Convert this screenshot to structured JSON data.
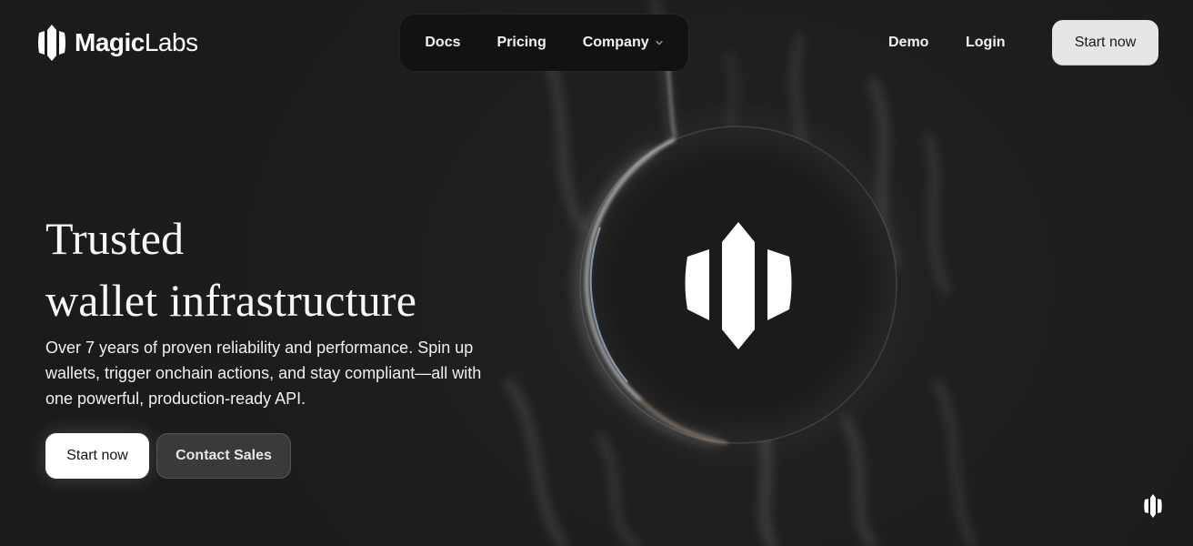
{
  "brand": {
    "name_bold": "Magic",
    "name_light": "Labs",
    "logo_icon": "magic-logo-icon"
  },
  "nav": {
    "items": [
      {
        "label": "Docs"
      },
      {
        "label": "Pricing"
      },
      {
        "label": "Company",
        "icon": "chevron-down-icon"
      }
    ]
  },
  "header_actions": {
    "demo": "Demo",
    "login": "Login",
    "start_now": "Start now"
  },
  "hero": {
    "title_line1": "Trusted",
    "title_line2": "wallet infrastructure",
    "subtitle": "Over 7 years of proven reliability and performance. Spin up wallets, trigger onchain actions, and stay compliant—all with one powerful, production-ready API.",
    "primary_button": "Start now",
    "secondary_button": "Contact Sales"
  },
  "colors": {
    "background": "#1d1d1d",
    "nav_pill": "#121212",
    "header_button": "#e6e6e6",
    "primary_button": "#ffffff",
    "secondary_button": "#3a3a3a"
  }
}
